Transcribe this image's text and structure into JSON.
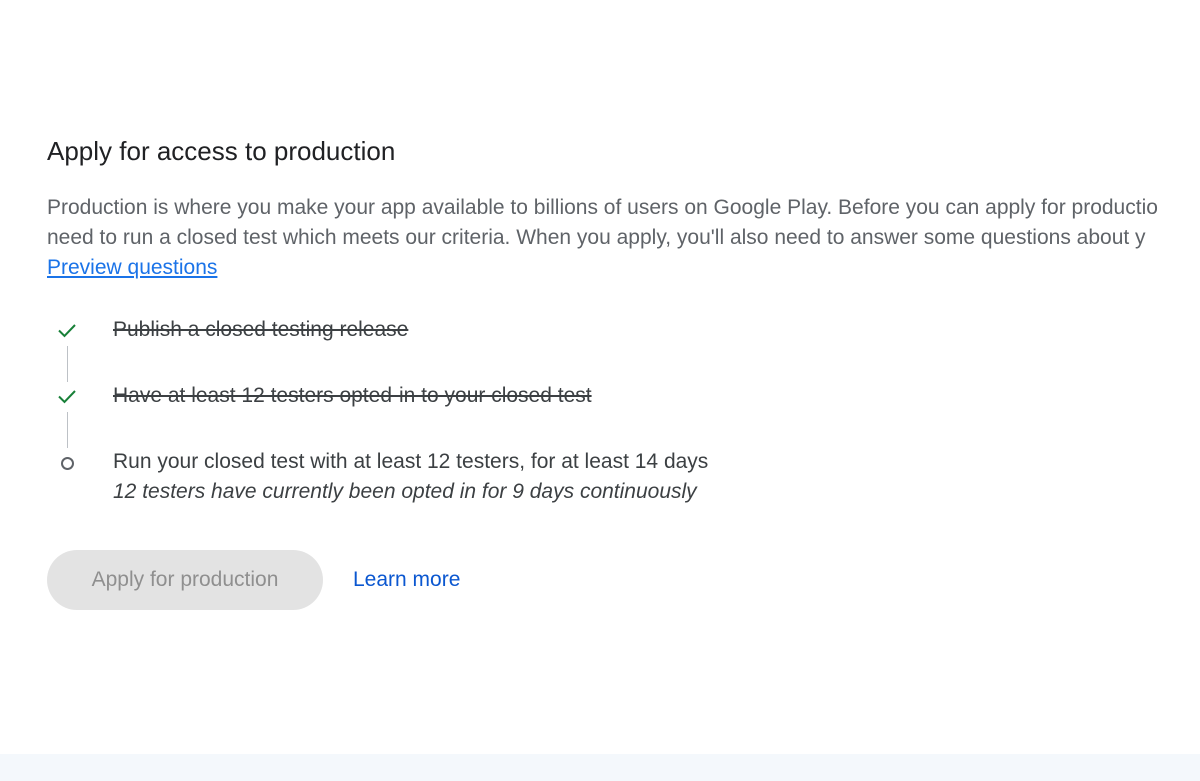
{
  "section": {
    "title": "Apply for access to production",
    "description_line1": "Production is where you make your app available to billions of users on Google Play. Before you can apply for productio",
    "description_line2": "need to run a closed test which meets our criteria. When you apply, you'll also need to answer some questions about y",
    "preview_link": "Preview questions"
  },
  "steps": [
    {
      "label": "Publish a closed testing release",
      "status": "complete"
    },
    {
      "label": "Have at least 12 testers opted-in to your closed test",
      "status": "complete"
    },
    {
      "label": "Run your closed test with at least 12 testers, for at least 14 days",
      "status": "in-progress",
      "detail": "12 testers have currently been opted in for 9 days continuously"
    }
  ],
  "actions": {
    "apply_label": "Apply for production",
    "learn_more_label": "Learn more"
  },
  "colors": {
    "check": "#188038",
    "link": "#1a73e8",
    "button_disabled_bg": "#e3e3e3"
  },
  "icons": {
    "complete": "checkmark-icon",
    "pending": "circle-icon"
  }
}
